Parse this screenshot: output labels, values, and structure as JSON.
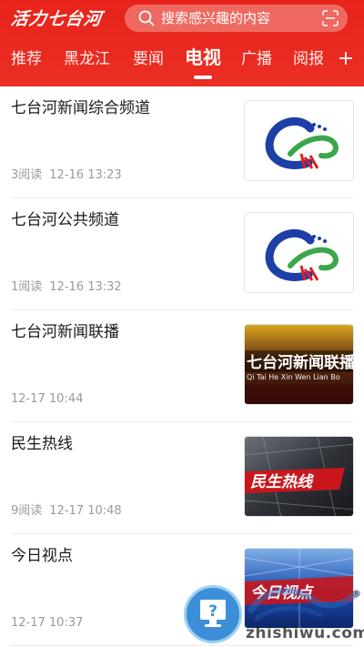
{
  "header": {
    "logo_text": "活力七台河",
    "search_placeholder": "搜索感兴趣的内容",
    "search_icon": "search-icon",
    "scan_icon": "scan-icon",
    "accent_color": "#e8231b"
  },
  "tabs": [
    {
      "label": "推荐",
      "active": false
    },
    {
      "label": "黑龙江",
      "active": false
    },
    {
      "label": "要闻",
      "active": false
    },
    {
      "label": "电视",
      "active": true
    },
    {
      "label": "广播",
      "active": false
    },
    {
      "label": "阅报",
      "active": false
    }
  ],
  "add_tab_icon": "plus-icon",
  "items": [
    {
      "title": "七台河新闻综合频道",
      "reads": "3阅读",
      "time": "12-16 13:23",
      "thumb": "channel-logo"
    },
    {
      "title": "七台河公共频道",
      "reads": "1阅读",
      "time": "12-16 13:32",
      "thumb": "channel-logo"
    },
    {
      "title": "七台河新闻联播",
      "reads": "",
      "time": "12-17 10:44",
      "thumb": "news-broadcast",
      "thumb_text": "七台河新闻联播",
      "thumb_subtext": "Qi Tai He Xin Wen Lian Bo"
    },
    {
      "title": "民生热线",
      "reads": "9阅读",
      "time": "12-17 10:48",
      "thumb": "hotline",
      "thumb_text": "民生热线"
    },
    {
      "title": "今日视点",
      "reads": "",
      "time": "12-17 10:37",
      "thumb": "today-view",
      "thumb_text": "今日视点"
    }
  ],
  "watermark": {
    "url": "zhishiwu.com",
    "reg": "®"
  }
}
